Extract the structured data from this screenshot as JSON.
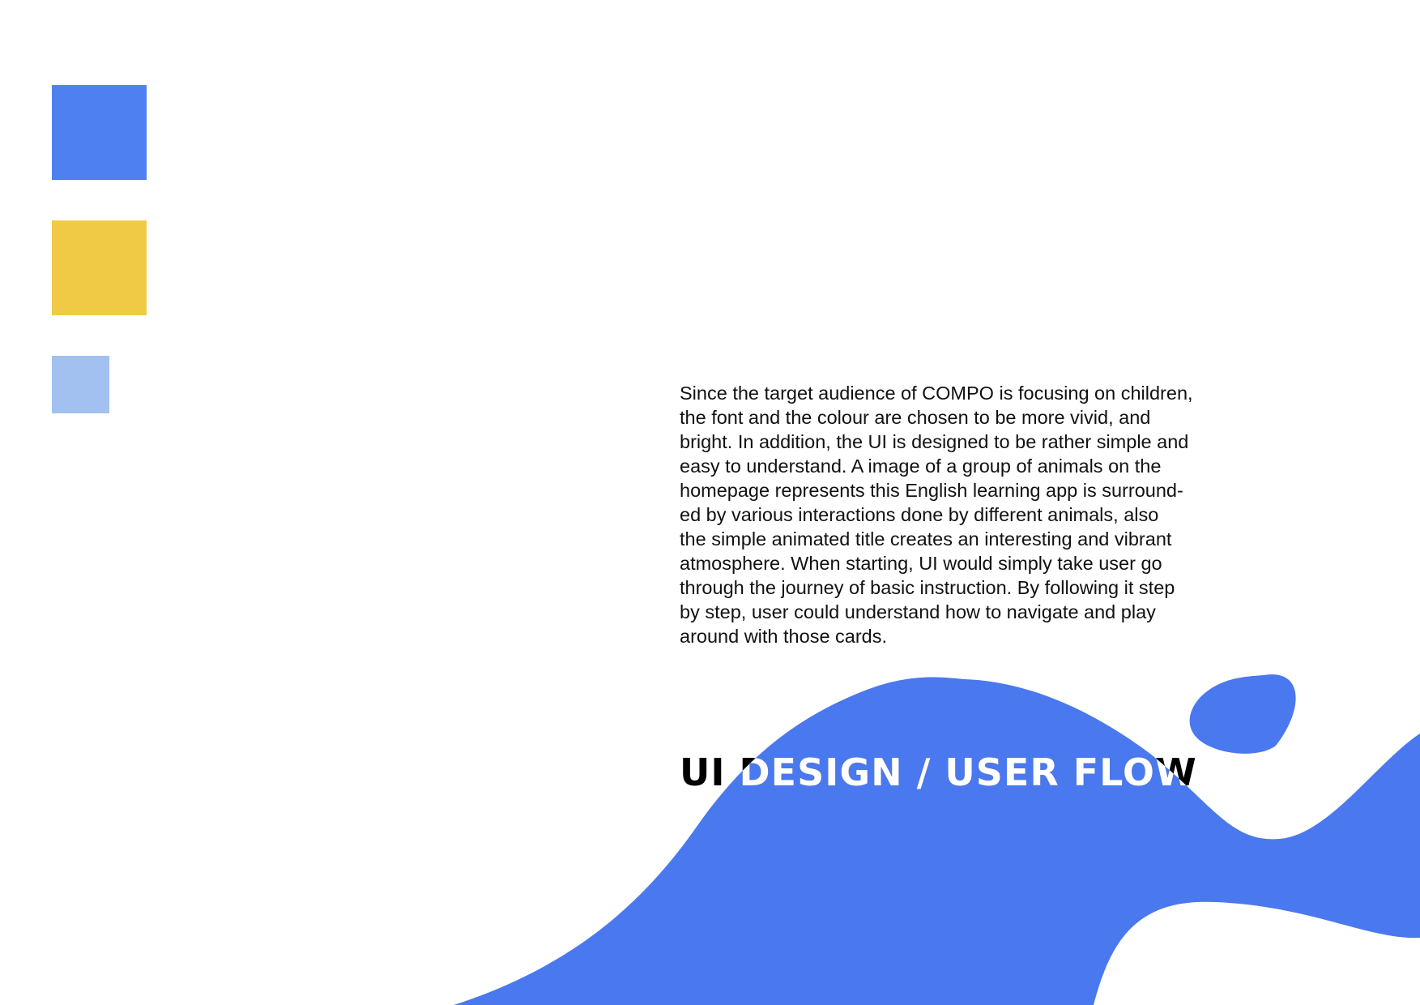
{
  "palette": {
    "swatches": [
      {
        "name": "primary-blue",
        "color": "#4E80F1"
      },
      {
        "name": "yellow",
        "color": "#F0CA45"
      },
      {
        "name": "light-blue",
        "color": "#A3C1F0"
      }
    ],
    "blob_color": "#4A78EE"
  },
  "description": "Since the target audience of COMPO is focusing on children,\nthe font and the colour are chosen to be more vivid, and\nbright. In addition, the UI is designed to be rather simple and\neasy to understand. A image of a group of animals on the\nhomepage represents this English learning app is surround-\ned by various interactions done by different animals, also\nthe simple animated title creates an interesting and vibrant\natmosphere. When starting, UI would simply take user go\nthrough the journey of basic instruction. By following it step\nby step, user could understand how to navigate and play\naround with those cards.",
  "title": "UI DESIGN / USER FLOW"
}
